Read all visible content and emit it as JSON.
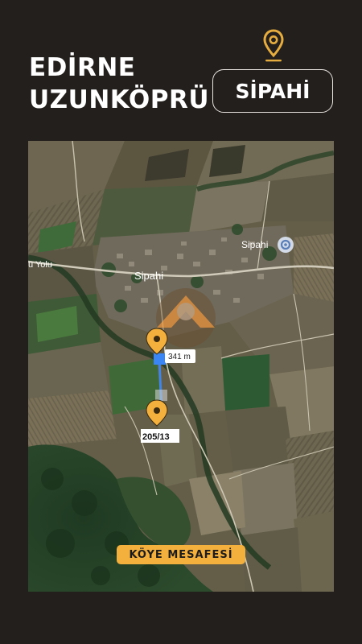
{
  "header": {
    "province": "EDİRNE",
    "district": "UZUNKÖPRÜ",
    "village": "SİPAHİ"
  },
  "map": {
    "village_label": "Sipahi",
    "place_label": "Sipahi",
    "road_label": "ü Yolu",
    "distance_label": "341 m",
    "parcel_label": "205/13",
    "badge": "KÖYE MESAFESİ"
  },
  "icons": {
    "header_pin": "location-pin-icon",
    "parcel_pin": "location-pin-icon",
    "place_marker": "place-marker-icon"
  },
  "colors": {
    "background": "#231f1d",
    "accent": "#f4b03d",
    "route": "#3d8af7"
  }
}
